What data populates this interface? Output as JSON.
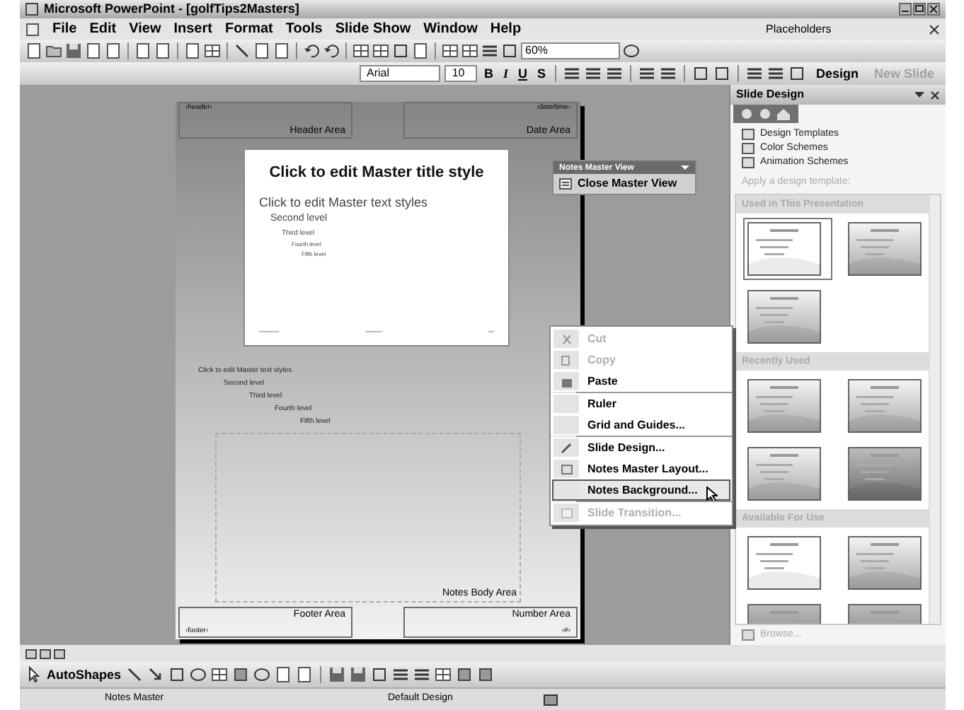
{
  "window": {
    "title": "Microsoft PowerPoint - [golfTips2Masters]"
  },
  "menu_bar": {
    "items": [
      "File",
      "Edit",
      "View",
      "Insert",
      "Format",
      "Tools",
      "Slide Show",
      "Window",
      "Help"
    ],
    "help_field": {
      "value": "Placeholders"
    }
  },
  "standard_toolbar": {
    "zoom": "60%"
  },
  "formatting_toolbar": {
    "font": "Arial",
    "size": "10",
    "buttons": [
      {
        "label": "B"
      },
      {
        "label": "I"
      },
      {
        "label": "U"
      },
      {
        "label": "S"
      }
    ],
    "design": {
      "label": "Design",
      "disabled": false
    },
    "new_slide": {
      "label": "New Slide",
      "disabled": true
    }
  },
  "notes_page": {
    "header_placeholder": "‹header›",
    "header_label": "Header Area",
    "date_placeholder": "‹date/time›",
    "date_label": "Date Area",
    "slide": {
      "title": "Click to edit Master title style",
      "text": [
        {
          "text": "Click to edit Master text styles",
          "children": [
            {
              "text": "Second level",
              "children": [
                {
                  "text": "Third level",
                  "children": [
                    {
                      "text": "Fourth level",
                      "children": [
                        {
                          "text": "Fifth level"
                        }
                      ]
                    }
                  ]
                }
              ]
            }
          ]
        }
      ]
    },
    "notes_text": [
      {
        "text": "Click to edit Master text styles",
        "children": [
          {
            "text": "Second level",
            "children": [
              {
                "text": "Third level",
                "children": [
                  {
                    "text": "Fourth level",
                    "children": [
                      {
                        "text": "Fifth level"
                      }
                    ]
                  }
                ]
              }
            ]
          }
        ]
      }
    ],
    "body_label": "Notes Body Area",
    "footer_label": "Footer Area",
    "footer_placeholder": "‹footer›",
    "number_label": "Number Area",
    "number_placeholder": "‹#›"
  },
  "notes_master_toolbar": {
    "title": "Notes Master View",
    "button": "Close Master View"
  },
  "context_menu": [
    {
      "label": "Cut",
      "disabled": true,
      "highlighted": false,
      "separator_after": false
    },
    {
      "label": "Copy",
      "disabled": true,
      "highlighted": false,
      "separator_after": false
    },
    {
      "label": "Paste",
      "disabled": false,
      "highlighted": false,
      "separator_after": true
    },
    {
      "label": "Ruler",
      "disabled": false,
      "highlighted": false,
      "separator_after": false
    },
    {
      "label": "Grid and Guides...",
      "disabled": false,
      "highlighted": false,
      "separator_after": true
    },
    {
      "label": "Slide Design...",
      "disabled": false,
      "highlighted": false,
      "separator_after": false
    },
    {
      "label": "Notes Master Layout...",
      "disabled": false,
      "highlighted": false,
      "separator_after": false
    },
    {
      "label": "Notes Background...",
      "disabled": false,
      "highlighted": true,
      "separator_after": true
    },
    {
      "label": "Slide Transition...",
      "disabled": true,
      "highlighted": false,
      "separator_after": false
    }
  ],
  "task_pane": {
    "title": "Slide Design",
    "links": [
      "Design Templates",
      "Color Schemes",
      "Animation Schemes"
    ],
    "apply_label": "Apply a design template:",
    "sections": [
      {
        "title": "Used in This Presentation",
        "thumbnails": [
          {
            "kind": "plain",
            "selected": true
          },
          {
            "kind": "gradient",
            "selected": false
          },
          {
            "kind": "gradient",
            "selected": false
          }
        ]
      },
      {
        "title": "Recently Used",
        "thumbnails": [
          {
            "kind": "gradient",
            "selected": false
          },
          {
            "kind": "gradient",
            "selected": false
          },
          {
            "kind": "gradient",
            "selected": false
          },
          {
            "kind": "dark",
            "selected": false
          }
        ]
      },
      {
        "title": "Available For Use",
        "thumbnails": [
          {
            "kind": "plain",
            "selected": false
          },
          {
            "kind": "gradient",
            "selected": false
          },
          {
            "kind": "dark",
            "selected": false
          },
          {
            "kind": "dark",
            "selected": false
          }
        ]
      }
    ],
    "browse": "Browse..."
  },
  "drawing_toolbar": {
    "autoshapes": "AutoShapes"
  },
  "status_bar": [
    "Notes Master",
    "Default Design"
  ]
}
